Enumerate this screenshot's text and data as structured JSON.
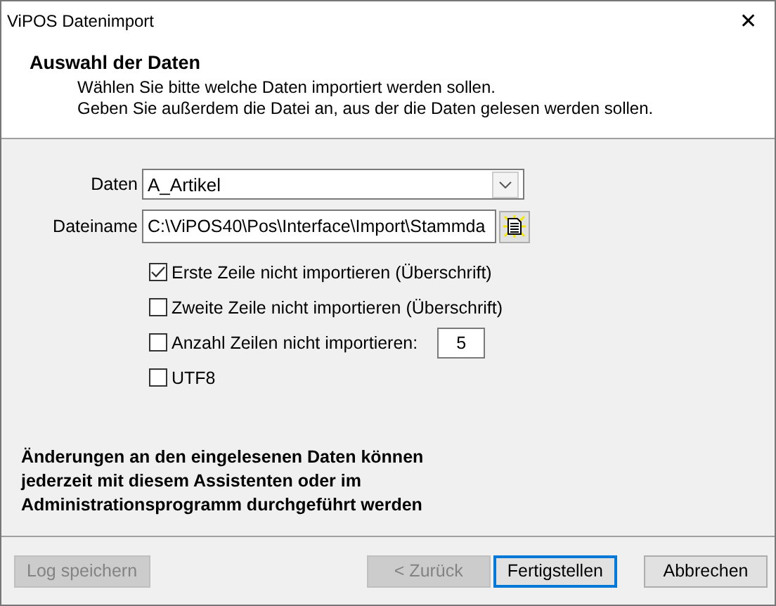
{
  "window": {
    "title": "ViPOS Datenimport",
    "close": "✕"
  },
  "header": {
    "title": "Auswahl der Daten",
    "lines": [
      "Wählen Sie bitte welche Daten importiert werden sollen.",
      "Geben Sie außerdem die Datei an, aus der die Daten gelesen werden sollen."
    ]
  },
  "data_field": {
    "label": "Daten",
    "value": "A_Artikel"
  },
  "file_field": {
    "label": "Dateiname",
    "value": "C:\\ViPOS40\\Pos\\Interface\\Import\\Stammda"
  },
  "options": [
    {
      "label": "Erste Zeile nicht importieren (Überschrift)",
      "checked": true
    },
    {
      "label": "Zweite Zeile nicht importieren (Überschrift)",
      "checked": false
    },
    {
      "label": "Anzahl Zeilen nicht importieren:",
      "checked": false,
      "value": "5"
    },
    {
      "label": "UTF8",
      "checked": false
    }
  ],
  "note": "Änderungen an den eingelesenen Daten können jederzeit mit diesem Assistenten oder im Administrationsprogramm durchgeführt werden",
  "buttons": [
    {
      "label": "Log speichern",
      "disabled": true,
      "default": false,
      "kind": "left"
    },
    {
      "label": "< Zurück",
      "disabled": true,
      "default": false,
      "kind": "right"
    },
    {
      "label": "Fertigstellen",
      "disabled": false,
      "default": true,
      "kind": "right"
    },
    {
      "label": "Abbrechen",
      "disabled": false,
      "default": false,
      "kind": "right"
    }
  ]
}
